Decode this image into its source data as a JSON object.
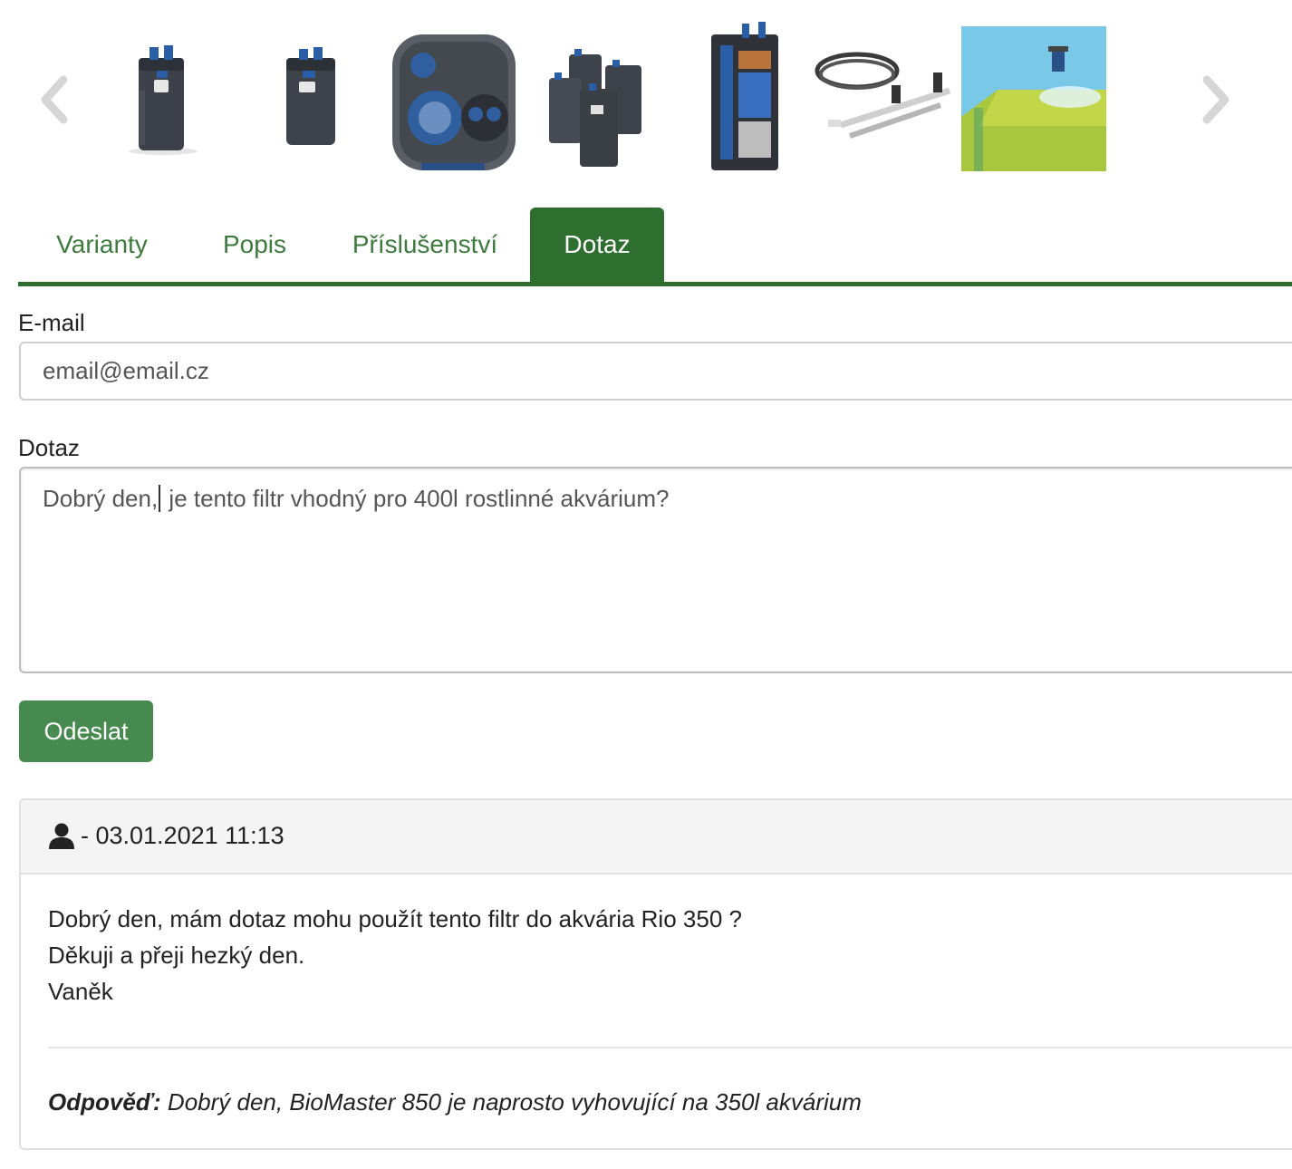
{
  "gallery": {
    "prev_icon": "chevron-left-icon",
    "next_icon": "chevron-right-icon",
    "thumbnails": [
      "filter-front",
      "filter-angle",
      "filter-lid-top",
      "filter-family",
      "filter-cutaway",
      "hoses-accessories",
      "aquarium-outflow"
    ]
  },
  "tabs": [
    {
      "label": "Varianty",
      "active": false
    },
    {
      "label": "Popis",
      "active": false
    },
    {
      "label": "Příslušenství",
      "active": false
    },
    {
      "label": "Dotaz",
      "active": true
    }
  ],
  "form": {
    "email_label": "E-mail",
    "email_value": "email@email.cz",
    "question_label": "Dotaz",
    "question_before_caret": "Dobrý den,",
    "question_after_caret": " je tento filtr vhodný pro 400l rostlinné akvárium?",
    "submit_label": "Odeslat"
  },
  "comment": {
    "user_icon": "user-icon",
    "meta": "- 03.01.2021 11:13",
    "lines": [
      "Dobrý den, mám dotaz mohu použít tento filtr do akvária Rio 350 ?",
      "Děkuji a přeji hezký den.",
      "Vaněk"
    ],
    "answer_label": "Odpověď:",
    "answer_text": " Dobrý den, BioMaster 850 je naprosto vyhovující na 350l akvárium"
  },
  "colors": {
    "brand_green": "#2e6e2e",
    "button_green": "#478a4f",
    "tab_text_green": "#3d7a3d"
  }
}
